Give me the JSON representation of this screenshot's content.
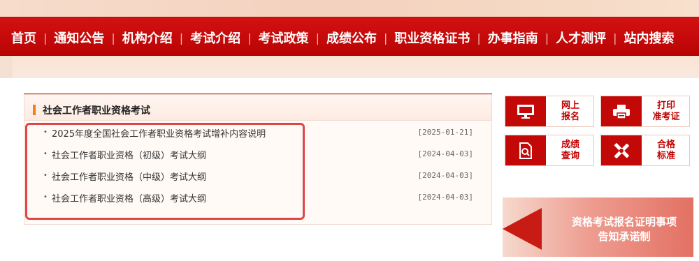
{
  "nav": {
    "items": [
      "首页",
      "通知公告",
      "机构介绍",
      "考试介绍",
      "考试政策",
      "成绩公布",
      "职业资格证书",
      "办事指南",
      "人才测评",
      "站内搜索"
    ]
  },
  "panel": {
    "title": "社会工作者职业资格考试",
    "items": [
      {
        "title": "2025年度全国社会工作者职业资格考试增补内容说明",
        "date": "[2025-01-21]"
      },
      {
        "title": "社会工作者职业资格（初级）考试大纲",
        "date": "[2024-04-03]"
      },
      {
        "title": "社会工作者职业资格（中级）考试大纲",
        "date": "[2024-04-03]"
      },
      {
        "title": "社会工作者职业资格（高级）考试大纲",
        "date": "[2024-04-03]"
      }
    ]
  },
  "quicklinks": {
    "online_register": [
      "网上",
      "报名"
    ],
    "print_ticket": [
      "打印",
      "准考证"
    ],
    "score_query": [
      "成绩",
      "查询"
    ],
    "pass_standard": [
      "合格",
      "标准"
    ]
  },
  "promo": {
    "line1": "资格考试报名证明事项",
    "line2": "告知承诺制"
  },
  "colors": {
    "nav_red": "#c30808",
    "accent_orange": "#f27f1b",
    "highlight_red": "#e14545"
  },
  "icons": [
    "monitor-icon",
    "printer-icon",
    "search-document-icon",
    "tools-icon",
    "arrow-left-icon"
  ]
}
